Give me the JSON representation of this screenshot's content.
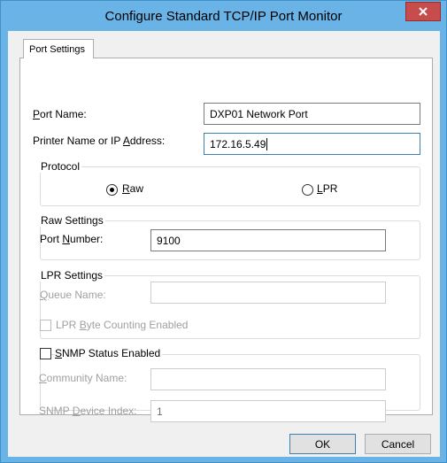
{
  "window": {
    "title": "Configure Standard TCP/IP Port Monitor"
  },
  "tabs": [
    {
      "label": "Port Settings"
    }
  ],
  "fields": {
    "port_name": {
      "label_pre": "",
      "label_mn": "P",
      "label_post": "ort Name:",
      "value": "DXP01 Network Port"
    },
    "printer_name": {
      "label_pre": "Printer Name or IP ",
      "label_mn": "A",
      "label_post": "ddress:",
      "value": "172.16.5.49"
    }
  },
  "protocol": {
    "legend": "Protocol",
    "raw": {
      "label_mn": "R",
      "label_post": "aw",
      "checked": true
    },
    "lpr": {
      "label_mn": "L",
      "label_post": "PR",
      "checked": false
    }
  },
  "raw_settings": {
    "legend": "Raw Settings",
    "port_number": {
      "label_pre": "Port ",
      "label_mn": "N",
      "label_post": "umber:",
      "value": "9100"
    }
  },
  "lpr_settings": {
    "legend": "LPR Settings",
    "queue_name": {
      "label_pre": "",
      "label_mn": "Q",
      "label_post": "ueue Name:",
      "value": ""
    },
    "byte_counting": {
      "label_pre": "LPR ",
      "label_mn": "B",
      "label_post": "yte Counting Enabled",
      "checked": false
    }
  },
  "snmp": {
    "enabled": {
      "label_pre": "",
      "label_mn": "S",
      "label_post": "NMP Status Enabled",
      "checked": false
    },
    "community_name": {
      "label_pre": "",
      "label_mn": "C",
      "label_post": "ommunity Name:",
      "value": ""
    },
    "device_index": {
      "label_pre": "SNMP ",
      "label_mn": "D",
      "label_post": "evice Index:",
      "value": "1"
    }
  },
  "buttons": {
    "ok": "OK",
    "cancel": "Cancel"
  },
  "colors": {
    "title_bar": "#6ab3e6",
    "close_button": "#c74d4d",
    "focus_border": "#3c7fb1"
  }
}
